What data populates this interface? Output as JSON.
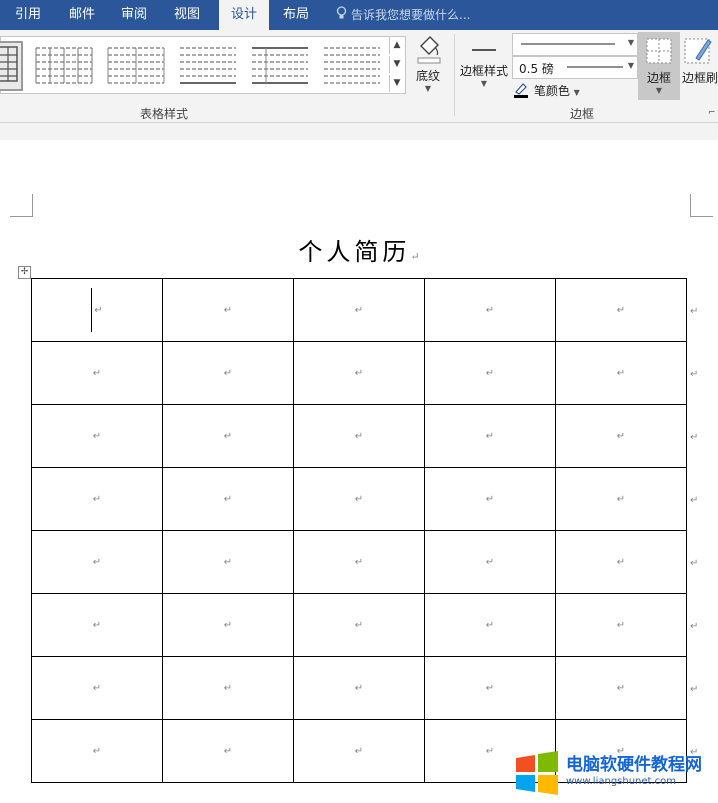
{
  "tabs": [
    {
      "label": "引用",
      "active": false
    },
    {
      "label": "邮件",
      "active": false
    },
    {
      "label": "审阅",
      "active": false
    },
    {
      "label": "视图",
      "active": false
    },
    {
      "label": "设计",
      "active": true
    },
    {
      "label": "布局",
      "active": false
    }
  ],
  "tell_me": "告诉我您想要做什么...",
  "ribbon": {
    "table_styles_label": "表格样式",
    "shading_label": "底纹",
    "border_styles_label": "边框样式",
    "line_weight": "0.5 磅",
    "pen_color_label": "笔颜色",
    "borders_group_label": "边框",
    "borders_button_label": "边框",
    "border_painter_label": "边框刷"
  },
  "document": {
    "title": "个人简历",
    "paragraph_mark": "↵",
    "table": {
      "rows": 8,
      "cols": 5,
      "cells": [
        [
          "↵",
          "↵",
          "↵",
          "↵",
          "↵"
        ],
        [
          "↵",
          "↵",
          "↵",
          "↵",
          "↵"
        ],
        [
          "↵",
          "↵",
          "↵",
          "↵",
          "↵"
        ],
        [
          "↵",
          "↵",
          "↵",
          "↵",
          "↵"
        ],
        [
          "↵",
          "↵",
          "↵",
          "↵",
          "↵"
        ],
        [
          "↵",
          "↵",
          "↵",
          "↵",
          "↵"
        ],
        [
          "↵",
          "↵",
          "↵",
          "↵",
          "↵"
        ],
        [
          "↵",
          "↵",
          "↵",
          "↵",
          "↵"
        ]
      ],
      "row_end_mark": "↵"
    }
  },
  "watermark": {
    "title": "电脑软硬件教程网",
    "url": "www.liangshunet.com"
  },
  "colors": {
    "tab_bar": "#2b579a",
    "ribbon": "#f3f3f3",
    "watermark_text": "#1565d8"
  }
}
